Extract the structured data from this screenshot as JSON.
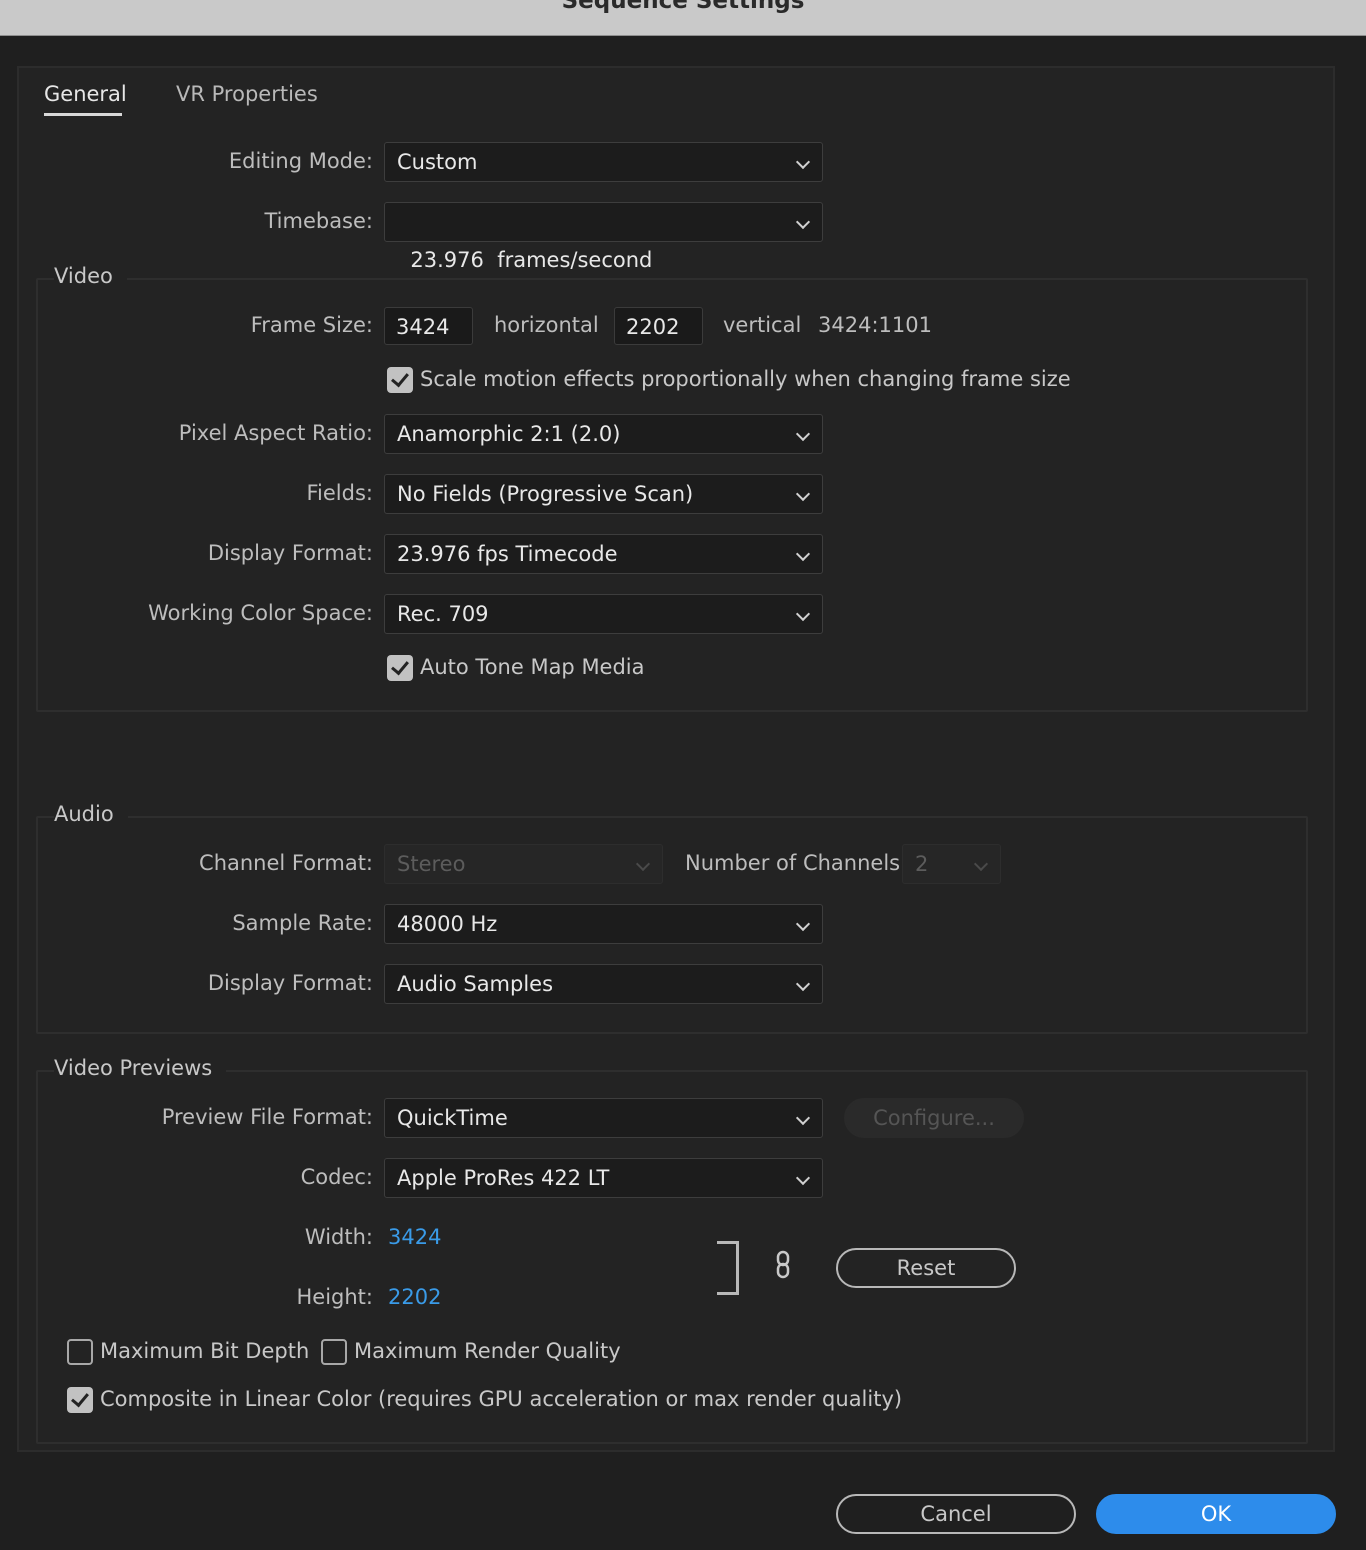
{
  "window": {
    "title": "Sequence Settings"
  },
  "tabs": [
    {
      "label": "General",
      "active": true
    },
    {
      "label": "VR Properties",
      "active": false
    }
  ],
  "general": {
    "editing_mode_label": "Editing Mode:",
    "editing_mode": "Custom",
    "timebase_label": "Timebase:",
    "timebase": "23.976  frames/second"
  },
  "video": {
    "section_title": "Video",
    "frame_size_label": "Frame Size:",
    "frame_width": "3424",
    "horizontal_label": "horizontal",
    "frame_height": "2202",
    "vertical_label": "vertical",
    "aspect": "3424:1101",
    "scale_motion_label": "Scale motion effects proportionally when changing frame size",
    "scale_motion_checked": true,
    "pixel_aspect_label": "Pixel Aspect Ratio:",
    "pixel_aspect": "Anamorphic 2:1 (2.0)",
    "fields_label": "Fields:",
    "fields": "No Fields (Progressive Scan)",
    "display_format_label": "Display Format:",
    "display_format": "23.976 fps Timecode",
    "color_space_label": "Working Color Space:",
    "color_space": "Rec. 709",
    "auto_tone_label": "Auto Tone Map Media",
    "auto_tone_checked": true
  },
  "audio": {
    "section_title": "Audio",
    "channel_format_label": "Channel Format:",
    "channel_format": "Stereo",
    "num_channels_label": "Number of Channels:",
    "num_channels": "2",
    "sample_rate_label": "Sample Rate:",
    "sample_rate": "48000 Hz",
    "display_format_label": "Display Format:",
    "display_format": "Audio Samples"
  },
  "previews": {
    "section_title": "Video Previews",
    "file_format_label": "Preview File Format:",
    "file_format": "QuickTime",
    "configure_label": "Configure...",
    "codec_label": "Codec:",
    "codec": "Apple ProRes 422 LT",
    "width_label": "Width:",
    "width": "3424",
    "height_label": "Height:",
    "height": "2202",
    "reset_label": "Reset",
    "max_bit_depth_label": "Maximum Bit Depth",
    "max_bit_depth_checked": false,
    "max_render_quality_label": "Maximum Render Quality",
    "max_render_quality_checked": false,
    "composite_linear_label": "Composite in Linear Color (requires GPU acceleration or max render quality)",
    "composite_linear_checked": true
  },
  "footer": {
    "cancel_label": "Cancel",
    "ok_label": "OK"
  },
  "colors": {
    "accent": "#2d8ceb",
    "link": "#3a9be8",
    "background": "#1f1f1f"
  }
}
